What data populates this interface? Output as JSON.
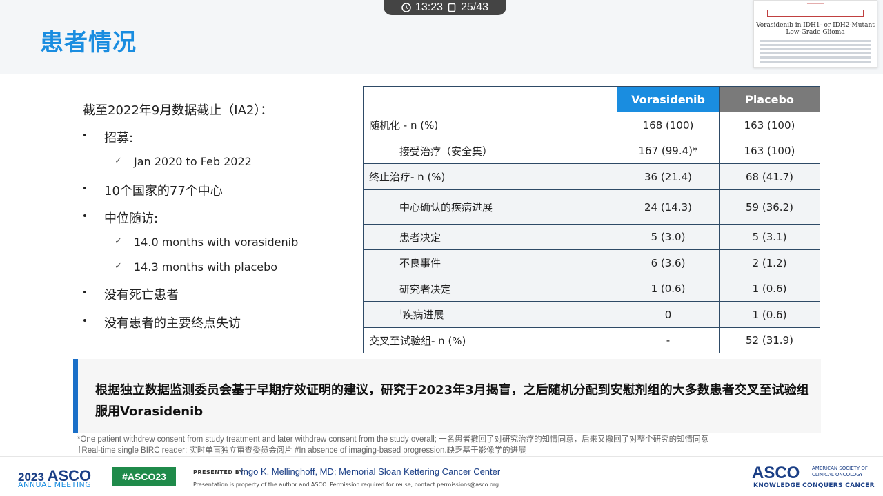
{
  "player": {
    "time": "13:23",
    "page": "25/43"
  },
  "slide": {
    "title": "患者情况",
    "paper_thumbnail": {
      "title_line1": "Vorasidenib in IDH1- or IDH2-Mutant",
      "title_line2": "Low-Grade Glioma"
    },
    "intro": "截至2022年9月数据截止（IA2）：",
    "bullets": {
      "recruit": "招募:",
      "recruit_period": "Jan 2020 to Feb 2022",
      "centers": "10个国家的77个中心",
      "followup": "中位随访:",
      "followup_vora": "14.0 months with vorasidenib",
      "followup_placebo": "14.3 months with placebo",
      "no_death": "没有死亡患者",
      "no_loss": "没有患者的主要终点失访"
    },
    "table": {
      "headers": [
        "Vorasidenib",
        "Placebo"
      ],
      "rows": [
        {
          "label": "随机化 - n (%)",
          "vora": "168 (100)",
          "placebo": "163 (100)"
        },
        {
          "label": "接受治疗（安全集）",
          "vora": "167 (99.4)*",
          "placebo": "163 (100)"
        },
        {
          "label": "终止治疗- n (%)",
          "vora": "36 (21.4)",
          "placebo": "68 (41.7)"
        },
        {
          "label": "中心确认的疾病进展",
          "vora": "24 (14.3)",
          "placebo": "59 (36.2)"
        },
        {
          "label": "患者决定",
          "vora": "5 (3.0)",
          "placebo": "5 (3.1)"
        },
        {
          "label": "不良事件",
          "vora": "6 (3.6)",
          "placebo": "2 (1.2)"
        },
        {
          "label": "研究者决定",
          "vora": "1 (0.6)",
          "placebo": "1 (0.6)"
        },
        {
          "label_mark": "‡",
          "label": "疾病进展",
          "vora": "0",
          "placebo": "1 (0.6)"
        },
        {
          "label": "交叉至试验组- n (%)",
          "vora": "-",
          "placebo": "52 (31.9)"
        }
      ]
    },
    "callout": "根据独立数据监测委员会基于早期疗效证明的建议，研究于2023年3月揭盲，之后随机分配到安慰剂组的大多数患者交叉至试验组服用Vorasidenib",
    "footnote1": "*One patient withdrew consent from study treatment and later withdrew consent from the study overall; 一名患者撤回了对研究治疗的知情同意，后来又撤回了对整个研究的知情同意",
    "footnote2": "†Real-time single BIRC reader; 实时单盲独立审查委员会阅片  #In absence of imaging-based progression.缺乏基于影像学的进展"
  },
  "footer": {
    "year": "2023",
    "brand": "ASCO",
    "meeting": "ANNUAL MEETING",
    "hashtag": "#ASCO23",
    "presented_by": "PRESENTED BY:",
    "presenter": "Ingo K. Mellinghoff, MD; Memorial Sloan Kettering Cancer Center",
    "note": "Presentation is property of the author and ASCO. Permission required for reuse; contact permissions@asco.org.",
    "logo": "ASCO",
    "org": "AMERICAN SOCIETY OF CLINICAL ONCOLOGY",
    "tagline": "KNOWLEDGE CONQUERS CANCER"
  },
  "colors": {
    "accent": "#1a8de0",
    "placebo_header": "#7a7a7a",
    "callout_bar": "#1a6fc8",
    "hashtag_bg": "#1f8a4a"
  }
}
